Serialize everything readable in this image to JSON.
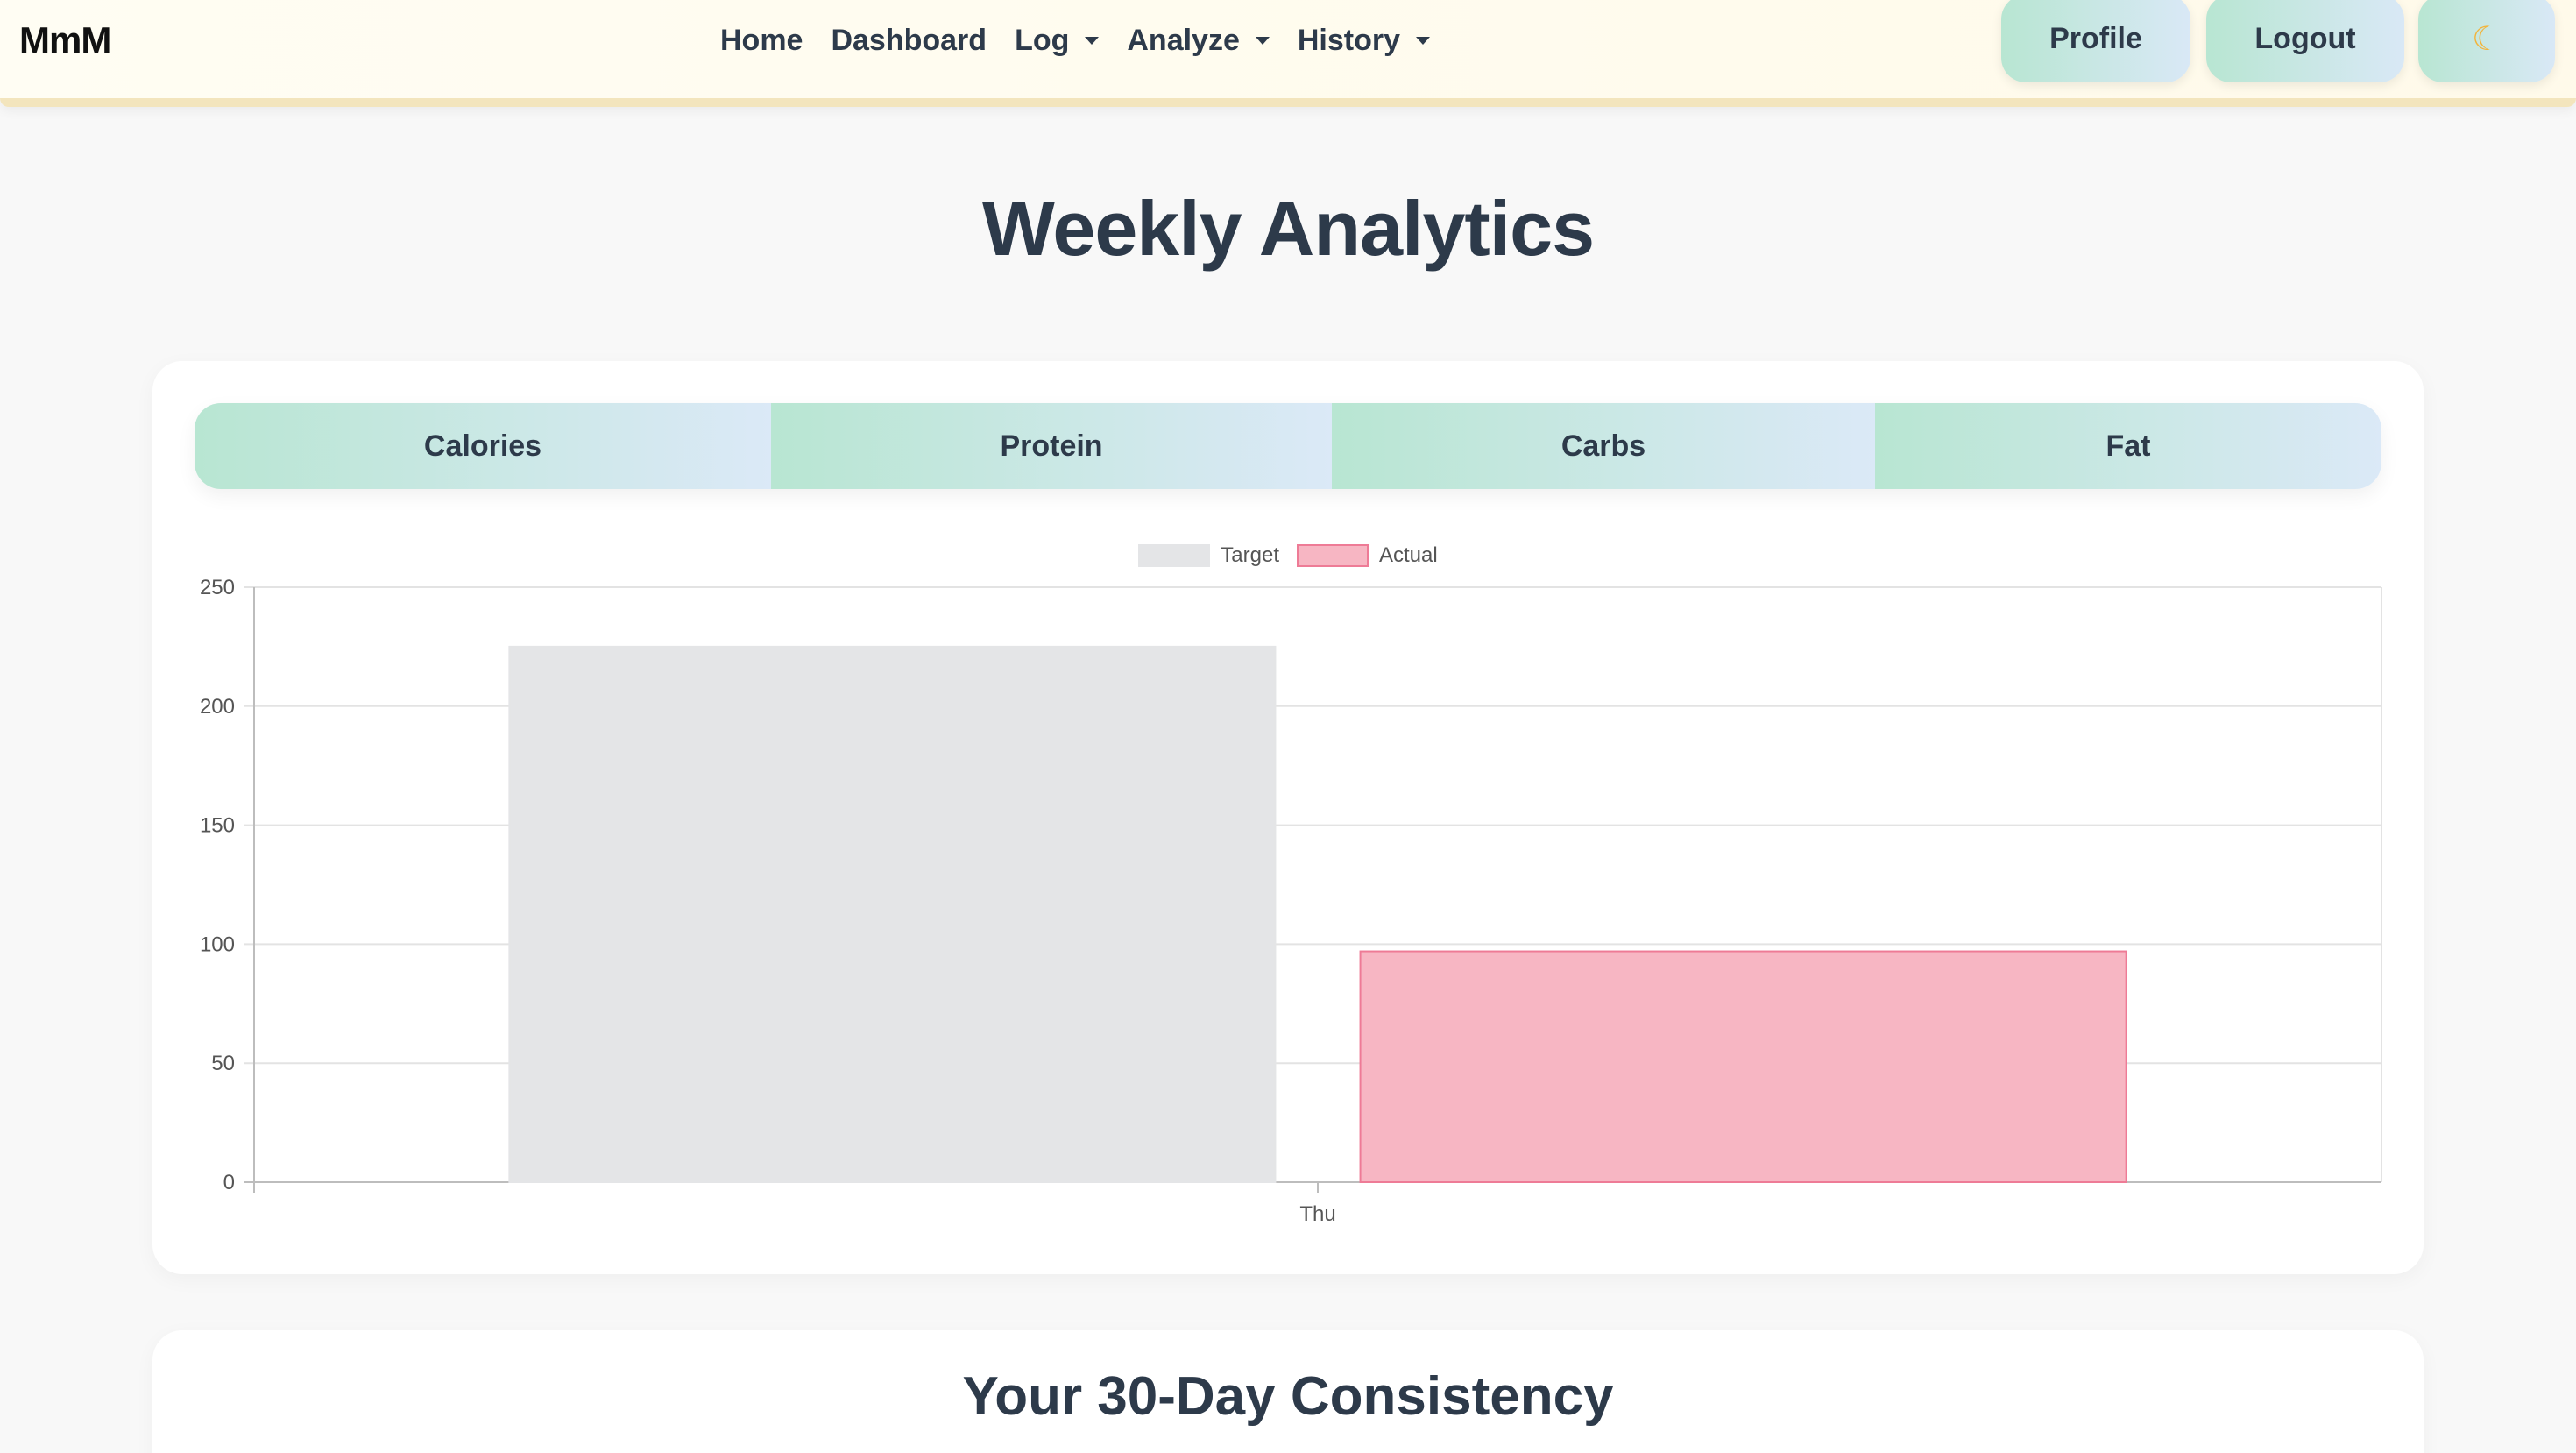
{
  "navbar": {
    "brand": "MmM",
    "links": [
      {
        "label": "Home",
        "dropdown": false
      },
      {
        "label": "Dashboard",
        "dropdown": false
      },
      {
        "label": "Log",
        "dropdown": true
      },
      {
        "label": "Analyze",
        "dropdown": true
      },
      {
        "label": "History",
        "dropdown": true
      }
    ],
    "profile_label": "Profile",
    "logout_label": "Logout",
    "theme_icon": "moon-icon"
  },
  "page": {
    "title": "Weekly Analytics"
  },
  "tabs": [
    {
      "label": "Calories"
    },
    {
      "label": "Protein"
    },
    {
      "label": "Carbs"
    },
    {
      "label": "Fat"
    }
  ],
  "colors": {
    "accent_gradient_start": "#b8e6d2",
    "accent_gradient_end": "#dbe9f7",
    "target_fill": "#e4e5e7",
    "actual_fill": "#f7b6c3",
    "actual_border": "#ee7b96",
    "heading": "#2d3a4a"
  },
  "chart_data": {
    "type": "bar",
    "categories": [
      "Thu"
    ],
    "series": [
      {
        "name": "Target",
        "values": [
          225
        ]
      },
      {
        "name": "Actual",
        "values": [
          97
        ]
      }
    ],
    "yticks": [
      0,
      50,
      100,
      150,
      200,
      250
    ],
    "ylim": [
      0,
      250
    ],
    "grid": true,
    "legend": "top-center"
  },
  "consistency": {
    "title": "Your 30-Day Consistency"
  }
}
